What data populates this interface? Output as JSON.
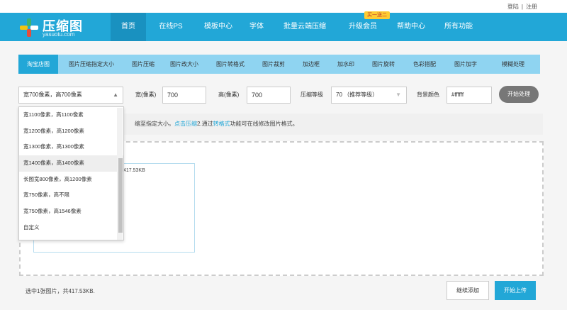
{
  "top_links": {
    "login": "登陆",
    "separator": "|",
    "register": "注册"
  },
  "brand": {
    "name": "压缩图",
    "domain": "yasuotu.com",
    "accent": "#22a7d7"
  },
  "nav": {
    "items": [
      {
        "label": "首页",
        "active": true
      },
      {
        "label": "在线PS"
      },
      {
        "label": "模板中心"
      },
      {
        "label": "字体"
      },
      {
        "label": "批量云端压缩"
      },
      {
        "label": "升级会员",
        "badge": "买一送二"
      },
      {
        "label": "帮助中心"
      },
      {
        "label": "所有功能"
      }
    ]
  },
  "tools": {
    "tabs": [
      {
        "label": "淘宝店图",
        "active": true
      },
      {
        "label": "图片压缩指定大小"
      },
      {
        "label": "图片压缩"
      },
      {
        "label": "图片改大小"
      },
      {
        "label": "图片转格式"
      },
      {
        "label": "图片裁剪"
      },
      {
        "label": "加边框"
      },
      {
        "label": "加水印"
      },
      {
        "label": "图片旋转"
      },
      {
        "label": "色彩搭配"
      },
      {
        "label": "图片加字"
      },
      {
        "label": "模糊处理"
      }
    ]
  },
  "options": {
    "size_select": "宽700像素，高700像素",
    "width_label": "宽(像素)",
    "width_value": "700",
    "height_label": "高(像素)",
    "height_value": "700",
    "quality_label": "压缩等级",
    "quality_value": "70 （推荐等级）",
    "bg_label": "背景颜色",
    "bg_value": "#ffffff",
    "start_button": "开始处理"
  },
  "dropdown": {
    "items": [
      "宽1100像素，高1100像素",
      "宽1200像素，高1200像素",
      "宽1300像素，高1300像素",
      "宽1400像素，高1400像素",
      "长图宽800像素，高1200像素",
      "宽750像素，高不限",
      "宽750像素，高1546像素",
      "自定义"
    ],
    "hover_index": 3
  },
  "info": {
    "text_before": "缩至指定大小。",
    "link1": "点击压缩",
    "text_middle": "2.通过",
    "link2": "转格式",
    "text_after": "功能可在线修改图片格式。"
  },
  "file": {
    "size": "417.53KB"
  },
  "footer": {
    "status": "选中1张图片，共417.53KB.",
    "continue_button": "继续添加",
    "upload_button": "开始上传"
  }
}
